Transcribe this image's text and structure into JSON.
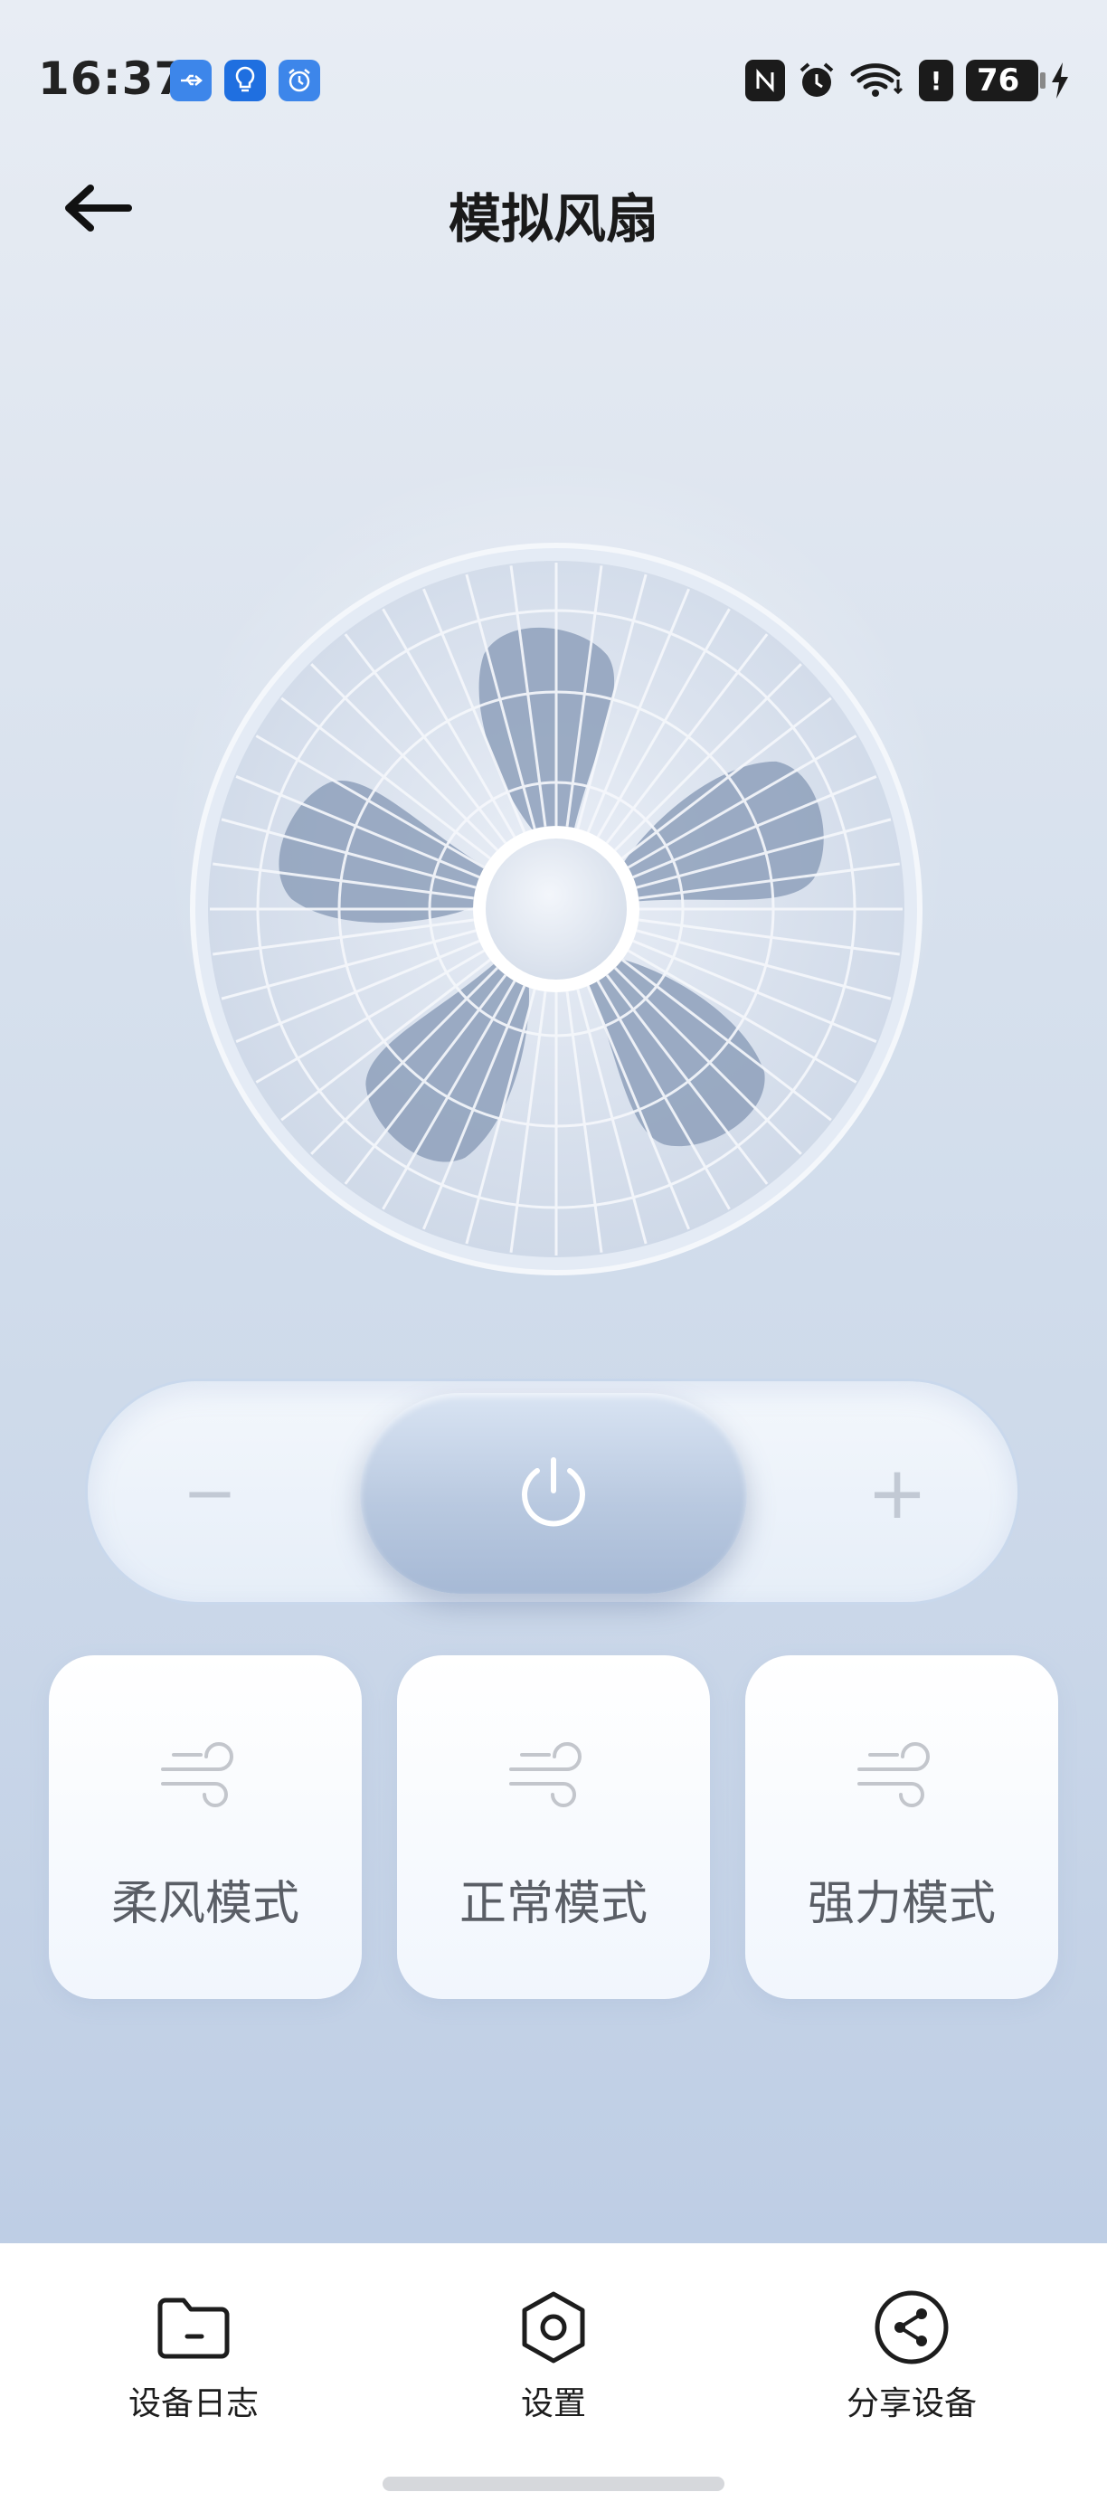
{
  "status_bar": {
    "time": "16:37",
    "battery_level": "76",
    "icons": [
      "usb-icon",
      "bulb-icon",
      "alarm-icon",
      "nfc-icon",
      "alarm-clock-icon",
      "wifi-icon",
      "alert-icon",
      "battery-icon",
      "charging-icon"
    ]
  },
  "header": {
    "title": "模拟风扇",
    "back_icon": "arrow-left-icon"
  },
  "fan": {
    "state": "off",
    "blade_count": 5
  },
  "power_control": {
    "minus_label": "−",
    "plus_label": "+",
    "power_icon": "power-icon"
  },
  "modes": [
    {
      "label": "柔风模式",
      "icon": "wind-icon"
    },
    {
      "label": "正常模式",
      "icon": "wind-icon"
    },
    {
      "label": "强力模式",
      "icon": "wind-icon"
    }
  ],
  "bottom_nav": [
    {
      "label": "设备日志",
      "icon": "folder-icon"
    },
    {
      "label": "设置",
      "icon": "hexagon-settings-icon"
    },
    {
      "label": "分享设备",
      "icon": "share-icon"
    }
  ],
  "colors": {
    "accent_blue": "#3d86ea",
    "background_top": "#e8edf4",
    "background_bottom": "#b9cae3",
    "fan_blade": "#8ea0bb"
  }
}
